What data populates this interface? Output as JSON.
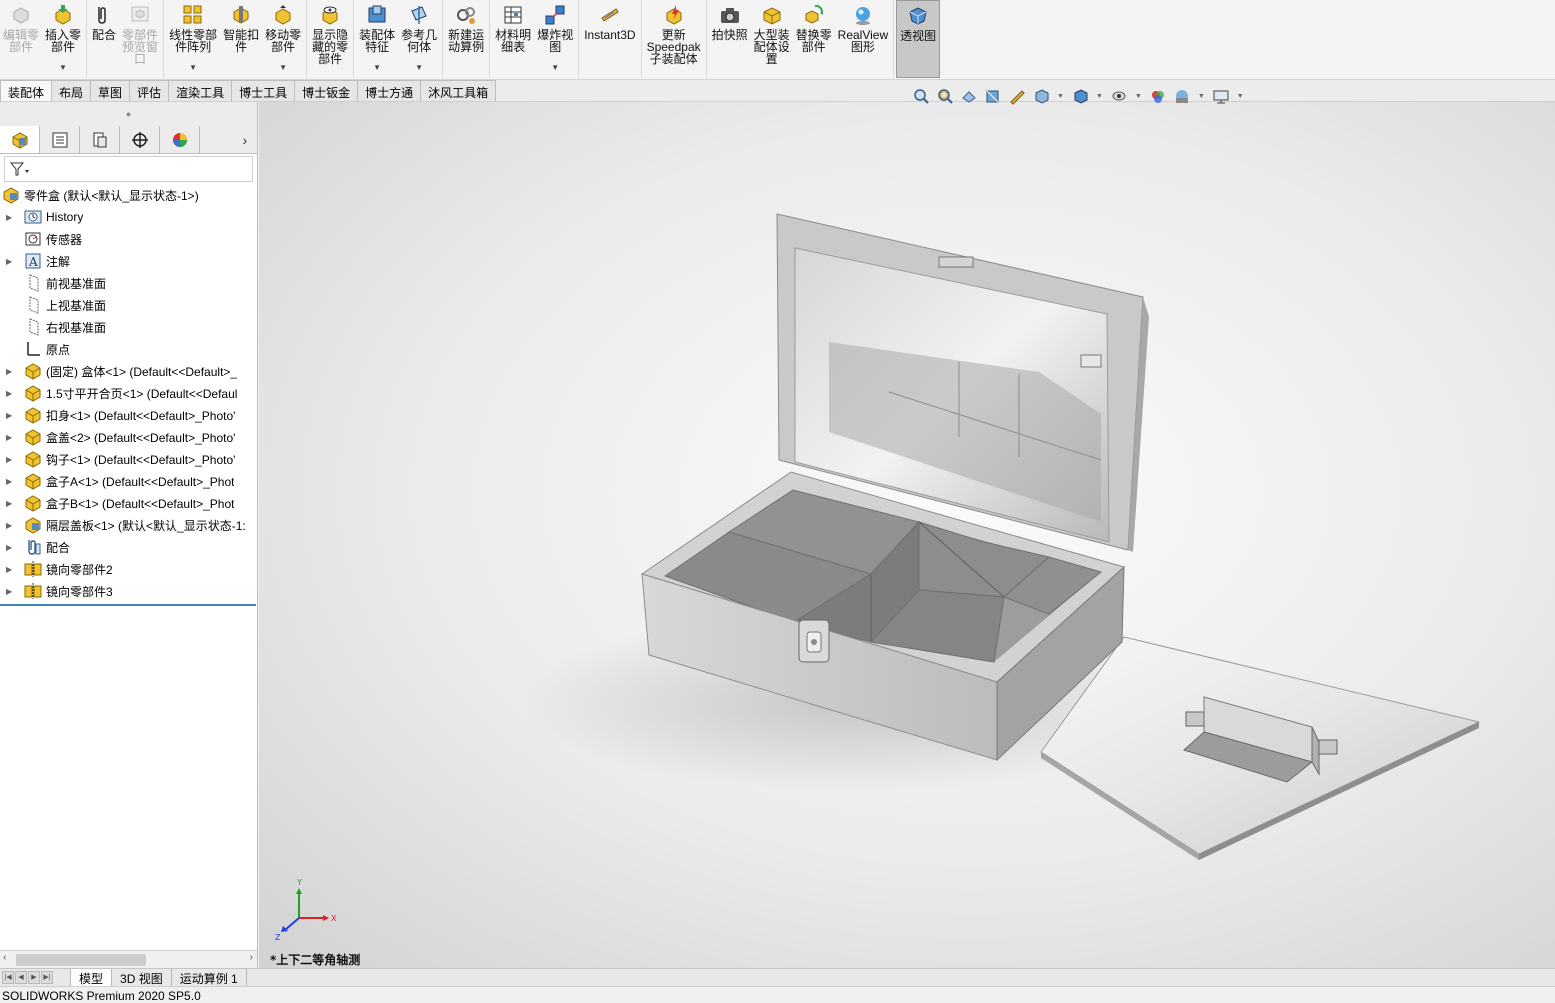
{
  "ribbon": {
    "buttons": [
      {
        "label": "编辑零\n部件",
        "disabled": true,
        "icon": "edit-component-icon"
      },
      {
        "label": "插入零\n部件",
        "icon": "insert-component-icon"
      },
      {
        "label": "配合",
        "icon": "mate-icon"
      },
      {
        "label": "零部件\n预览窗\n口",
        "disabled": true,
        "icon": "component-preview-icon"
      },
      {
        "label": "线性零部\n件阵列",
        "icon": "linear-pattern-icon"
      },
      {
        "label": "智能扣\n件",
        "icon": "smart-fastener-icon"
      },
      {
        "label": "移动零\n部件",
        "icon": "move-component-icon"
      },
      {
        "label": "显示隐\n藏的零\n部件",
        "icon": "show-hidden-icon"
      },
      {
        "label": "装配体\n特征",
        "icon": "assembly-feature-icon"
      },
      {
        "label": "参考几\n何体",
        "icon": "reference-geometry-icon"
      },
      {
        "label": "新建运\n动算例",
        "icon": "motion-study-icon"
      },
      {
        "label": "材料明\n细表",
        "icon": "bom-icon"
      },
      {
        "label": "爆炸视\n图",
        "icon": "explode-view-icon"
      },
      {
        "label": "Instant3D",
        "icon": "instant3d-icon"
      },
      {
        "label": "更新\nSpeedpak\n子装配体",
        "icon": "speedpak-icon"
      },
      {
        "label": "拍快照",
        "icon": "snapshot-icon"
      },
      {
        "label": "大型装\n配体设\n置",
        "icon": "large-assembly-icon"
      },
      {
        "label": "替换零\n部件",
        "icon": "replace-component-icon"
      },
      {
        "label": "RealView\n图形",
        "icon": "realview-icon"
      },
      {
        "label": "透视图",
        "icon": "perspective-icon",
        "active": true
      }
    ]
  },
  "command_tabs": [
    "装配体",
    "布局",
    "草图",
    "评估",
    "渲染工具",
    "博士工具",
    "博士钣金",
    "博士方通",
    "沐风工具箱"
  ],
  "tree": {
    "root": "零件盒 (默认<默认_显示状态-1>)",
    "items": [
      {
        "label": "History",
        "icon": "history-folder-icon",
        "expand": true
      },
      {
        "label": "传感器",
        "icon": "sensor-icon",
        "expand": false
      },
      {
        "label": "注解",
        "icon": "annotation-icon",
        "expand": true
      },
      {
        "label": "前视基准面",
        "icon": "plane-icon",
        "expand": false
      },
      {
        "label": "上视基准面",
        "icon": "plane-icon",
        "expand": false
      },
      {
        "label": "右视基准面",
        "icon": "plane-icon",
        "expand": false
      },
      {
        "label": "原点",
        "icon": "origin-icon",
        "expand": false
      },
      {
        "label": "(固定) 盒体<1> (Default<<Default>_",
        "icon": "part-icon",
        "expand": true
      },
      {
        "label": "1.5寸平开合页<1> (Default<<Defaul",
        "icon": "part-icon",
        "expand": true
      },
      {
        "label": "扣身<1> (Default<<Default>_Photo'",
        "icon": "part-icon",
        "expand": true
      },
      {
        "label": "盒盖<2> (Default<<Default>_Photo'",
        "icon": "part-icon",
        "expand": true
      },
      {
        "label": "钩子<1> (Default<<Default>_Photo'",
        "icon": "part-icon",
        "expand": true
      },
      {
        "label": "盒子A<1> (Default<<Default>_Phot",
        "icon": "part-icon",
        "expand": true
      },
      {
        "label": "盒子B<1> (Default<<Default>_Phot",
        "icon": "part-icon",
        "expand": true
      },
      {
        "label": "隔层盖板<1> (默认<默认_显示状态-1:",
        "icon": "subassembly-icon",
        "expand": true
      },
      {
        "label": "配合",
        "icon": "mates-folder-icon",
        "expand": true
      },
      {
        "label": "镜向零部件2",
        "icon": "mirror-component-icon",
        "expand": true
      },
      {
        "label": "镜向零部件3",
        "icon": "mirror-component-icon",
        "expand": true
      }
    ]
  },
  "viewport": {
    "view_name": "*上下二等角轴测",
    "triad": {
      "x": "X",
      "y": "Y",
      "z": "Z"
    }
  },
  "bottom_tabs": [
    "模型",
    "3D 视图",
    "运动算例 1"
  ],
  "status": "SOLIDWORKS Premium 2020 SP5.0",
  "colors": {
    "accent": "#3c83c2",
    "axis_x": "#e02020",
    "axis_y": "#20a020",
    "axis_z": "#2040e0"
  }
}
